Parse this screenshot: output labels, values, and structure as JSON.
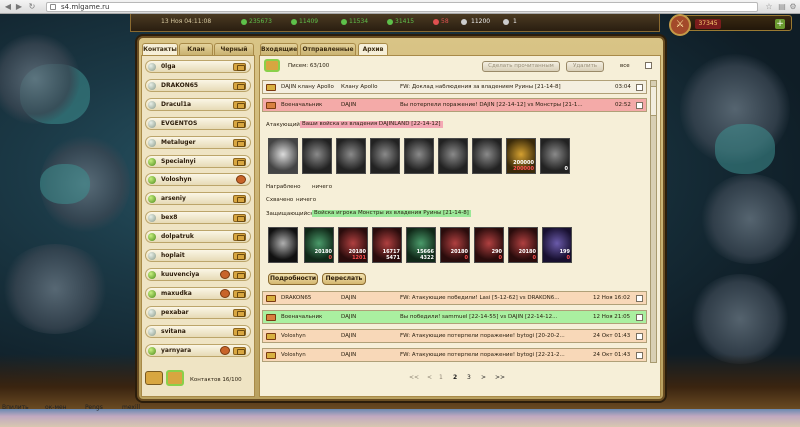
{
  "browser": {
    "url": "s4.mlgame.ru"
  },
  "hud": {
    "datetime": "13 Ноя 04:11:08",
    "res1": "235673",
    "res2": "11409",
    "res3": "11534",
    "res4": "31415",
    "res5": "58",
    "res6": "11200",
    "res7": "1",
    "gold": "37345",
    "plus": "+"
  },
  "contacts": {
    "tabs": [
      "Контакты",
      "Клан",
      "Черный спи"
    ],
    "items": [
      {
        "name": "0lga"
      },
      {
        "name": "DRAKON65"
      },
      {
        "name": "Dracul1a"
      },
      {
        "name": "EVGENTOS"
      },
      {
        "name": "Metaluger"
      },
      {
        "name": "Specialnyi"
      },
      {
        "name": "Voloshyn"
      },
      {
        "name": "arseniy"
      },
      {
        "name": "bex8"
      },
      {
        "name": "dolpatruk"
      },
      {
        "name": "hoplait"
      },
      {
        "name": "kuuvenciya"
      },
      {
        "name": "maxudka"
      },
      {
        "name": "pexabar"
      },
      {
        "name": "svitana"
      },
      {
        "name": "yarnyara"
      }
    ],
    "count": "Контактов 16/100"
  },
  "mail": {
    "tabs": [
      "Входящие",
      "Отправленные",
      "Архив"
    ],
    "letters": "Писем: 63/100",
    "mark_read": "Сделать прочитанным",
    "delete": "Удалить",
    "all": "все",
    "row1": {
      "from": "DAJIN клану Apollo",
      "to": "Клану Apollo",
      "subject": "FW: Доклад наблюдения за владением Руины [21-14-8]",
      "date": "03:04"
    },
    "row2": {
      "from": "Военачальник",
      "to": "DAJIN",
      "subject": "Вы потерпели поражение! DAJIN [22-14-12] vs Монстры [21-1...",
      "date": "02:52"
    },
    "detail": {
      "attacker_label": "Атакующий",
      "attacker_name": "Ваши войска из владения DAJINLAND [22-14-12]",
      "looted_label": "Награблено",
      "looted_value": "ничего",
      "captured_label": "Схвачено",
      "captured_value": "ничего",
      "defender_label": "Защищающийся",
      "defender_name": "Войска игрока Монстры из владения Руины [21-14-8]",
      "attackers": [
        {
          "n1": "",
          "n2": ""
        },
        {
          "n1": "",
          "n2": ""
        },
        {
          "n1": "",
          "n2": ""
        },
        {
          "n1": "",
          "n2": ""
        },
        {
          "n1": "",
          "n2": ""
        },
        {
          "n1": "",
          "n2": ""
        },
        {
          "n1": "",
          "n2": ""
        },
        {
          "n1": "200000",
          "n2": "200000"
        },
        {
          "n1": "",
          "n2": "0"
        }
      ],
      "defenders": [
        {
          "n1": "",
          "n2": ""
        },
        {
          "n1": "20180",
          "n2": "0"
        },
        {
          "n1": "20180",
          "n2": "1201"
        },
        {
          "n1": "16717",
          "n2": "5471"
        },
        {
          "n1": "15666",
          "n2": "4322"
        },
        {
          "n1": "20180",
          "n2": "0"
        },
        {
          "n1": "290",
          "n2": "0"
        },
        {
          "n1": "20180",
          "n2": "0"
        },
        {
          "n1": "199",
          "n2": "0"
        }
      ],
      "details_btn": "Подробности",
      "forward_btn": "Переслать"
    },
    "rows": [
      {
        "from": "DRAKON65",
        "to": "DAJIN",
        "subject": "FW: Атакующие победили! Lasi [5-12-62] vs DRAKON6...",
        "date": "12 Ноя 16:02"
      },
      {
        "from": "Военачальник",
        "to": "DAJIN",
        "subject": "Вы победили! sammuel [22-14-55] vs DAJIN [22-14-12...",
        "date": "12 Ноя 21:05"
      },
      {
        "from": "Voloshyn",
        "to": "DAJIN",
        "subject": "FW: Атакующие потерпели поражение! bytogi [20-20-2...",
        "date": "24 Окт 01:43"
      },
      {
        "from": "Voloshyn",
        "to": "DAJIN",
        "subject": "FW: Атакующие потерпели поражение! bytogi [22-21-2...",
        "date": "24 Окт 01:43"
      }
    ],
    "pager": {
      "first": "<<",
      "prev": "<",
      "p1": "1",
      "p2": "2",
      "p3": "3",
      "next": ">",
      "last": ">>"
    }
  },
  "taskbar": {
    "a": "Впилить",
    "b": "ок-мен",
    "c": "Pengs",
    "d": "mexill"
  }
}
